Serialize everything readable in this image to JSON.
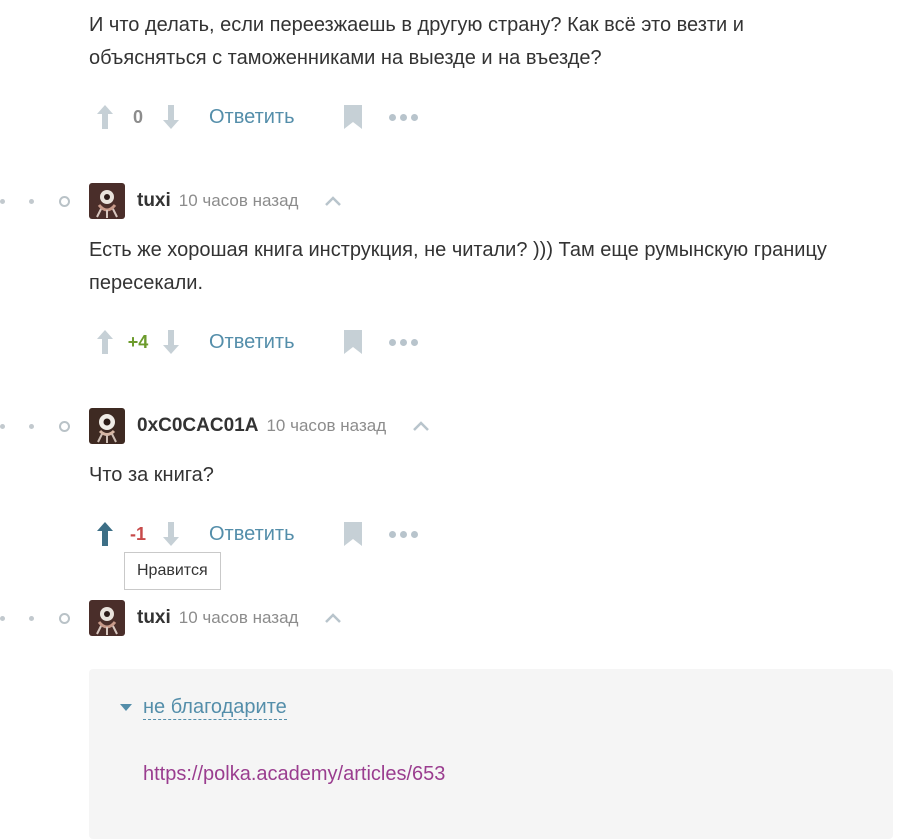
{
  "comments": [
    {
      "text": "И что делать, если переезжаешь в другую страну? Как всё это везти и объясняться с таможенниками на выезде и на въезде?",
      "score": "0",
      "reply_label": "Ответить"
    },
    {
      "username": "tuxi",
      "time": "10 часов назад",
      "text": "Есть же хорошая книга инструкция, не читали? ))) Там еще румынскую границу пересекали.",
      "score": "+4",
      "reply_label": "Ответить"
    },
    {
      "username": "0xC0CAC01A",
      "time": "10 часов назад",
      "text": "Что за книга?",
      "score": "-1",
      "reply_label": "Ответить",
      "tooltip": "Нравится"
    },
    {
      "username": "tuxi",
      "time": "10 часов назад",
      "spoiler_title": "не благодарите",
      "link": "https://polka.academy/articles/653"
    }
  ],
  "colors": {
    "link": "#548eaa",
    "positive": "#6c9b2c",
    "negative": "#c74a4a",
    "visited_link": "#9a3d8f"
  },
  "icons": [
    "arrow-up-icon",
    "arrow-down-icon",
    "bookmark-icon",
    "more-icon",
    "chevron-up-icon",
    "caret-down-icon",
    "avatar-image"
  ]
}
